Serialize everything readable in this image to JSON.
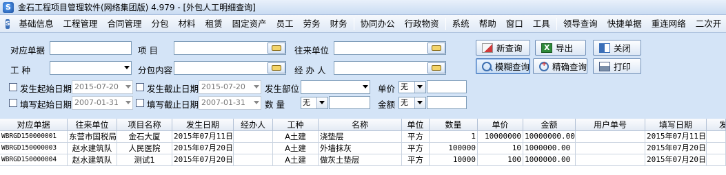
{
  "window": {
    "title": "金石工程项目管理软件(网络集团版) 4.979 - [外包人工明细查询]",
    "logo_text": "S"
  },
  "menu": {
    "logo_text": "S",
    "items": [
      "基础信息",
      "工程管理",
      "合同管理",
      "分包",
      "材料",
      "租赁",
      "固定资产",
      "员工",
      "劳务",
      "财务",
      "协同办公",
      "行政物资",
      "系统",
      "帮助",
      "窗口",
      "工具",
      "领导查询",
      "快捷单据",
      "重连网络",
      "二次开"
    ]
  },
  "filters": {
    "doc_no_label": "对应单据",
    "doc_no_value": "",
    "project_label": "项    目",
    "project_value": "",
    "partner_label": "往来单位",
    "partner_value": "",
    "work_type_label": "工    种",
    "work_type_value": "",
    "subcontract_label": "分包内容",
    "subcontract_value": "",
    "handler_label": "经 办 人",
    "handler_value": "",
    "occur_start_label": "发生起始日期",
    "occur_start_value": "2015-07-20",
    "occur_end_label": "发生截止日期",
    "occur_end_value": "2015-07-20",
    "dept_label": "发生部位",
    "dept_value": "",
    "unit_price_label": "单价",
    "unit_price_op": "无",
    "unit_price_value": "",
    "fill_start_label": "填写起始日期",
    "fill_start_value": "2007-01-31",
    "fill_end_label": "填写截止日期",
    "fill_end_value": "2007-01-31",
    "qty_label": "数    量",
    "qty_op": "无",
    "qty_value": "",
    "amount_label": "金额",
    "amount_op": "无",
    "amount_value": ""
  },
  "buttons": {
    "new_query": "新查询",
    "export": "导出",
    "close": "关闭",
    "fuzzy_query": "模糊查询",
    "precise_query": "精确查询",
    "print": "打印"
  },
  "table": {
    "columns": [
      "对应单据",
      "往来单位",
      "项目名称",
      "发生日期",
      "经办人",
      "工种",
      "名称",
      "单位",
      "数量",
      "单价",
      "金额",
      "用户单号",
      "填写日期",
      "发"
    ],
    "rows": [
      [
        "WBRGD150000001",
        "东营市国税局",
        "金石大厦",
        "2015年07月11日",
        "",
        "A土建",
        "浇垫层",
        "平方",
        "1",
        "10000000",
        "10000000.00",
        "",
        "2015年07月11日",
        ""
      ],
      [
        "WBRGD150000003",
        "赵水建筑队",
        "人民医院",
        "2015年07月20日",
        "",
        "A土建",
        "外墙抹灰",
        "平方",
        "100000",
        "10",
        "1000000.00",
        "",
        "2015年07月20日",
        ""
      ],
      [
        "WBRGD150000004",
        "赵水建筑队",
        "测试1",
        "2015年07月20日",
        "",
        "A土建",
        "做灰土垫层",
        "平方",
        "10000",
        "100",
        "1000000.00",
        "",
        "2015年07月20日",
        ""
      ]
    ]
  }
}
